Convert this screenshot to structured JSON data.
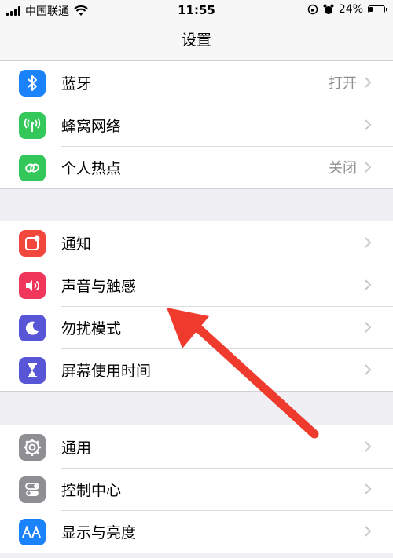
{
  "status": {
    "carrier": "中国联通",
    "time": "11:55",
    "battery": "24%",
    "battery_level": 0.24
  },
  "nav": {
    "title": "设置"
  },
  "groups": [
    {
      "rows": [
        {
          "label": "蓝牙",
          "value": "打开",
          "icon": "bluetooth-icon",
          "color": "#1a82fb"
        },
        {
          "label": "蜂窝网络",
          "value": "",
          "icon": "cellular-icon",
          "color": "#34c759"
        },
        {
          "label": "个人热点",
          "value": "关闭",
          "icon": "hotspot-icon",
          "color": "#34c759"
        }
      ]
    },
    {
      "rows": [
        {
          "label": "通知",
          "icon": "notifications-icon",
          "color": "#f2473d"
        },
        {
          "label": "声音与触感",
          "icon": "sound-icon",
          "color": "#f0365a"
        },
        {
          "label": "勿扰模式",
          "icon": "moon-icon",
          "color": "#5856d6"
        },
        {
          "label": "屏幕使用时间",
          "icon": "hourglass-icon",
          "color": "#5856d6"
        }
      ]
    },
    {
      "rows": [
        {
          "label": "通用",
          "icon": "gear-icon",
          "color": "#8e8e93"
        },
        {
          "label": "控制中心",
          "icon": "toggles-icon",
          "color": "#8e8e93"
        },
        {
          "label": "显示与亮度",
          "icon": "display-aa-icon",
          "color": "#1a82fb"
        }
      ]
    }
  ],
  "annotation": {
    "arrow_color": "#ef3b2d"
  }
}
